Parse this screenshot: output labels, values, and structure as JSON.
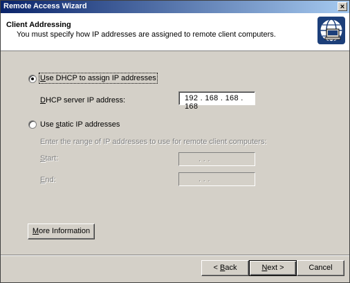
{
  "window": {
    "title": "Remote Access Wizard",
    "close_glyph": "×"
  },
  "header": {
    "title": "Client Addressing",
    "subtitle": "You must specify how IP addresses are assigned to remote client computers."
  },
  "options": {
    "dhcp": {
      "label_prefix": "",
      "label_hotkey": "U",
      "label_rest": "se DHCP to assign IP addresses",
      "selected": true
    },
    "dhcp_server": {
      "label_hotkey": "D",
      "label_rest": "HCP server IP address:",
      "value": "192 . 168 . 168 . 168"
    },
    "static": {
      "label_prefix": "Use ",
      "label_hotkey": "s",
      "label_rest": "tatic IP addresses",
      "selected": false
    },
    "range_text": "Enter the range of IP addresses to use for remote client computers:",
    "start": {
      "label_hotkey": "S",
      "label_rest": "tart:"
    },
    "end": {
      "label_hotkey": "E",
      "label_rest": "nd:"
    },
    "empty_ip": ".          .          ."
  },
  "buttons": {
    "more_info": {
      "hotkey": "M",
      "rest": "ore Information"
    },
    "back": {
      "prefix": "< ",
      "hotkey": "B",
      "rest": "ack"
    },
    "next": {
      "hotkey": "N",
      "rest": "ext >"
    },
    "cancel": "Cancel"
  },
  "icons": {
    "wizard": "network-globe-icon",
    "close": "close-icon"
  }
}
